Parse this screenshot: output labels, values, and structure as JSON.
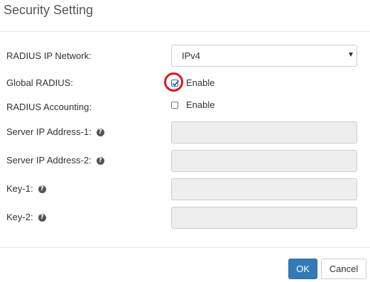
{
  "dialog": {
    "title": "Security Setting"
  },
  "form": {
    "radius_ip_network": {
      "label": "RADIUS IP Network:",
      "selected": "IPv4"
    },
    "global_radius": {
      "label": "Global RADIUS:",
      "checkbox_label": "Enable",
      "checked": true
    },
    "radius_accounting": {
      "label": "RADIUS Accounting:",
      "checkbox_label": "Enable",
      "checked": false
    },
    "server_ip_1": {
      "label": "Server IP Address-1:",
      "value": "",
      "help_icon": "question-circle-icon"
    },
    "server_ip_2": {
      "label": "Server IP Address-2:",
      "value": "",
      "help_icon": "question-circle-icon"
    },
    "key_1": {
      "label": "Key-1:",
      "value": "",
      "help_icon": "question-circle-icon"
    },
    "key_2": {
      "label": "Key-2:",
      "value": "",
      "help_icon": "question-circle-icon"
    }
  },
  "footer": {
    "ok_label": "OK",
    "cancel_label": "Cancel"
  },
  "colors": {
    "primary": "#337ab7",
    "highlight_ring": "#e5131d",
    "disabled_input": "#eeeeee"
  }
}
